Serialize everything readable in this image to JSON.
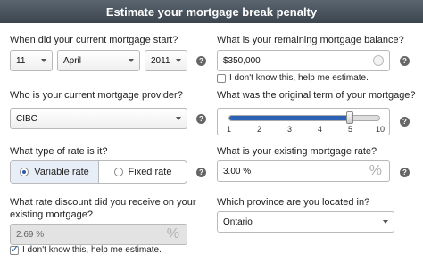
{
  "header": {
    "title": "Estimate your mortgage break penalty"
  },
  "start": {
    "question": "When did your current mortgage start?",
    "day": "11",
    "month": "April",
    "year": "2011"
  },
  "balance": {
    "question": "What is your remaining mortgage balance?",
    "value": "$350,000",
    "dont_know": "I don't know this, help me estimate.",
    "dont_know_checked": false
  },
  "provider": {
    "question": "Who is your current mortgage provider?",
    "value": "CIBC"
  },
  "term": {
    "question": "What was the original term of your mortgage?",
    "ticks": [
      "1",
      "2",
      "3",
      "4",
      "5",
      "10"
    ],
    "selected": "5"
  },
  "rate_type": {
    "question": "What type of rate is it?",
    "options": [
      "Variable rate",
      "Fixed rate"
    ],
    "selected": "Variable rate"
  },
  "existing_rate": {
    "question": "What is your existing mortgage rate?",
    "value": "3.00",
    "unit": "%"
  },
  "discount": {
    "question": "What rate discount did you receive on your existing mortgage?",
    "value": "2.69",
    "unit": "%",
    "dont_know": "I don't know this, help me estimate.",
    "dont_know_checked": true
  },
  "province": {
    "question": "Which province are you located in?",
    "value": "Ontario"
  },
  "help_glyph": "?",
  "colors": {
    "header": "#444d56",
    "accent": "#2c62b5"
  }
}
